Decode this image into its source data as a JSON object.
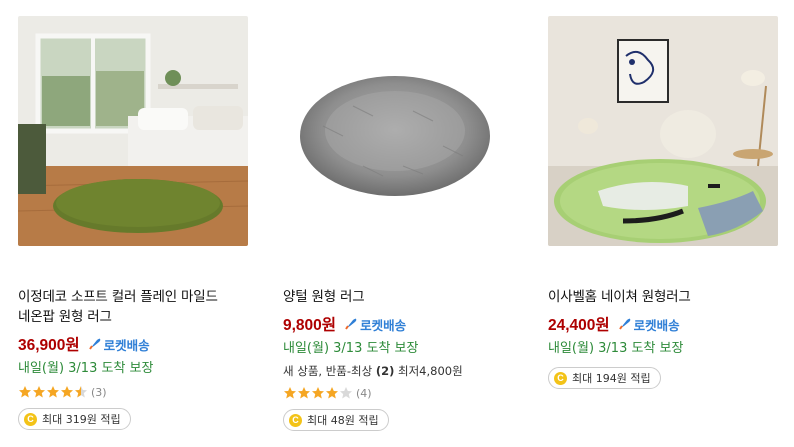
{
  "products": [
    {
      "name_line1": "이정데코 소프트 컬러 플레인 마일드",
      "name_line2": "네온팝 원형 러그",
      "price": "36,900원",
      "rocket_label": "로켓배송",
      "delivery": "내일(월) 3/13 도착 보장",
      "rating": 4.5,
      "review_count": "(3)",
      "cashback": "최대 319원 적립",
      "image_icon": "green-round-rug-bedroom-photo"
    },
    {
      "name_line1": "양털 원형 러그",
      "price": "9,800원",
      "rocket_label": "로켓배송",
      "delivery": "내일(월) 3/13 도착 보장",
      "extra_prefix": "새 상품, 반품-최상 ",
      "extra_count": "(2)",
      "extra_suffix": " 최저4,800원",
      "rating": 4.0,
      "review_count": "(4)",
      "cashback": "최대 48원 적립",
      "image_icon": "gray-fur-round-rug-photo"
    },
    {
      "name_line1": "이사벨홈 네이쳐 원형러그",
      "price": "24,400원",
      "rocket_label": "로켓배송",
      "delivery": "내일(월) 3/13 도착 보장",
      "cashback": "최대 194원 적립",
      "image_icon": "nature-round-rug-livingroom-photo"
    }
  ],
  "colors": {
    "price": "#ae0000",
    "rocket": "#2f7fd6",
    "delivery": "#2e8b3a",
    "star": "#f5a623",
    "coin": "#f3c318"
  },
  "coin_symbol": "C"
}
